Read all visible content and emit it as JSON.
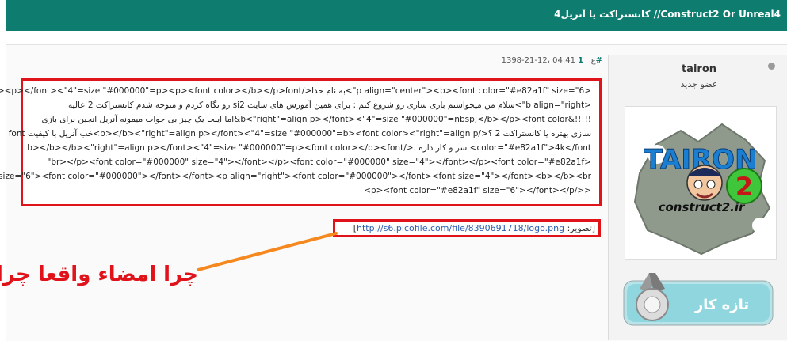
{
  "thread": {
    "title": "کانستراکت یا آنریل4 //Construct2 Or Unreal4"
  },
  "user": {
    "name": "tairon",
    "rank": "عضو جدید",
    "avatar_text": "TAIRON",
    "avatar_number": "2",
    "avatar_site": "construct2.ir",
    "badge_label": "تازه کار"
  },
  "post": {
    "number": "1#",
    "datetime": "1398-21-12، 04:41 ع",
    "lines": [
      "<p align=\"center\"><b><font color=\"#e82a1f\" size=\"6\">به نام خدا</font><p></font><\"4\"=size \"#000000\"=p><p><font color></b></p>font",
      "<b align=\"right\">سلام من میخواستم بازی سازی رو شروع کنم : برای همین آموزش های سایت si2 رو نگاه کردم و متوجه شدم کانستراکت 2 عالیه",
      "!!!!!&b<\"right\"=align p></font><\"4\"=size \"#000000\"=nbsp;</b></p><font color&اما اینجا یک چیز بی جواب میمونه آنریل انجین برای بازی",
      "سازی بهتره یا کانستراکت 2 ؟</b></b><\"right\"=align p></font><\"4\"=size \"#000000\"=b><font color><\"right\"=align p>خب آنریل با کیفیت font",
      "color=\"#e82a1f\">4k</font> سر و کار داره .</b></b></b><\"right\"=align p></font><\"4\"=size \"#000000\"=p><font color></b><font",
      "<br></p><font color=\"#000000\" size=\"4\"></font></p><font color=\"#000000\" size=\"4\"></font></p><font color=\"#e82a1f\"",
      "size=\"6\"><font color=\"#000000\"></font></font><p align=\"right\"><font color=\"#000000\"></font><font size=\"4\"></font><b></b><br>",
      "<</p><font color=\"#e82a1f\" size=\"6\"></font></p>"
    ]
  },
  "image_link": {
    "label": "[تصویر: ",
    "url": "http://s6.picofile.com/file/8390691718/logo.png",
    "close": "]"
  },
  "annotation": {
    "text": "چرا امضاء واقعا چرا"
  },
  "colors": {
    "header": "#0e7d6f",
    "highlight_red": "#e0131a",
    "arrow_orange": "#f5881f"
  }
}
